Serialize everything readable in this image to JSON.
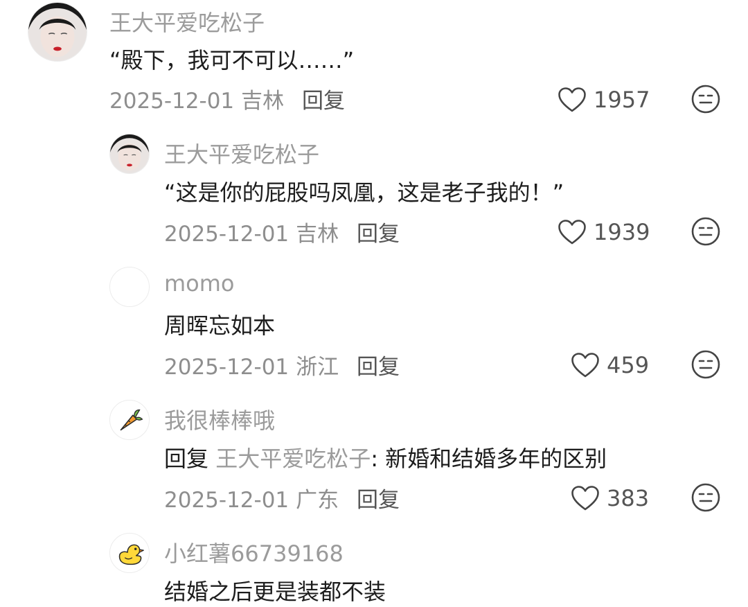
{
  "icons": {
    "like": "heart-outline-icon",
    "dislike": "neutral-face-icon"
  },
  "comments": [
    {
      "username": "王大平爱吃松子",
      "text": "“殿下，我可不可以……”",
      "date": "2025-12-01",
      "location": "吉林",
      "reply_label": "回复",
      "likes": "1957"
    },
    {
      "username": "王大平爱吃松子",
      "text": "“这是你的屁股吗凤凰，这是老子我的！”",
      "date": "2025-12-01",
      "location": "吉林",
      "reply_label": "回复",
      "likes": "1939"
    },
    {
      "username": "momo",
      "text": "周晖忘如本",
      "date": "2025-12-01",
      "location": "浙江",
      "reply_label": "回复",
      "likes": "459"
    },
    {
      "username": "我很棒棒哦",
      "reply_prefix": "回复",
      "reply_to": "王大平爱吃松子",
      "text": ": 新婚和结婚多年的区别",
      "date": "2025-12-01",
      "location": "广东",
      "reply_label": "回复",
      "likes": "383"
    },
    {
      "username": "小红薯66739168",
      "text": "结婚之后更是装都不装"
    }
  ]
}
